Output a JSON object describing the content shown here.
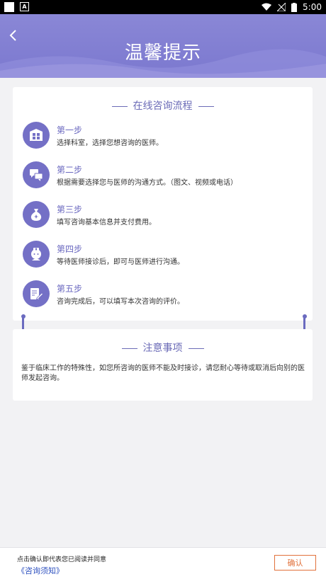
{
  "status_bar": {
    "time": "5:00"
  },
  "header": {
    "title": "温馨提示",
    "bg_color": "#7b78cf"
  },
  "process": {
    "title": "在线咨询流程",
    "steps": [
      {
        "title": "第一步",
        "desc": "选择科室，选择您想咨询的医师。",
        "icon": "department-grid-icon"
      },
      {
        "title": "第二步",
        "desc": "根据需要选择您与医师的沟通方式。（图文、视频或电话）",
        "icon": "chat-bubbles-icon"
      },
      {
        "title": "第三步",
        "desc": "填写咨询基本信息并支付费用。",
        "icon": "money-bag-icon"
      },
      {
        "title": "第四步",
        "desc": "等待医师接诊后，即可与医师进行沟通。",
        "icon": "doctor-icon"
      },
      {
        "title": "第五步",
        "desc": "咨询完成后，可以填写本次咨询的评价。",
        "icon": "edit-document-icon"
      }
    ]
  },
  "notice": {
    "title": "注意事项",
    "text": "鉴于临床工作的特殊性，如您所咨询的医师不能及时接诊，请您耐心等待或取消后向别的医师发起咨询。"
  },
  "bottom": {
    "agree_text": "点击确认即代表您已阅读并同意",
    "link_text": "《咨询须知》",
    "confirm_label": "确认"
  },
  "colors": {
    "accent": "#7470c6",
    "confirm": "#e1713b",
    "link": "#2c4fbf"
  }
}
